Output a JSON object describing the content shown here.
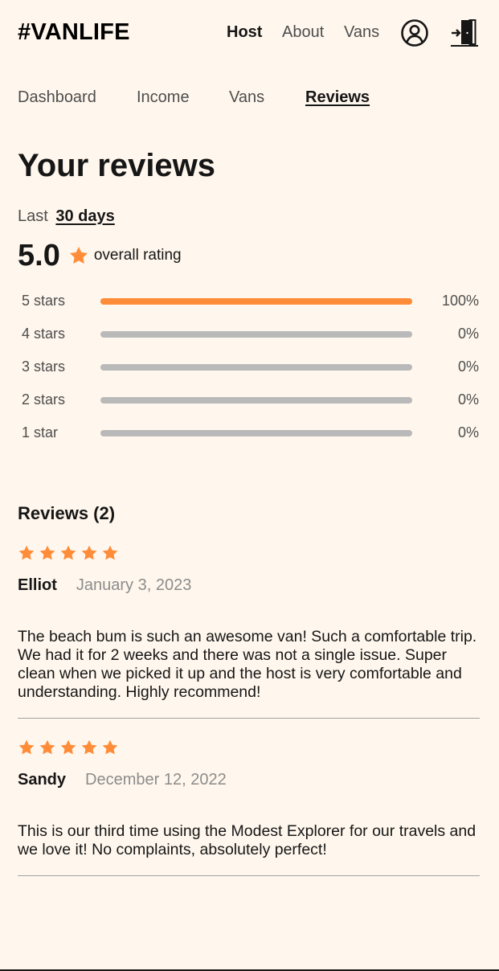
{
  "header": {
    "logo": "#VANLIFE",
    "nav": {
      "host": "Host",
      "about": "About",
      "vans": "Vans"
    },
    "user_icon": "user-circle-icon",
    "logout_icon": "logout-door-icon"
  },
  "subnav": {
    "dashboard": "Dashboard",
    "income": "Income",
    "vans": "Vans",
    "reviews": "Reviews"
  },
  "page": {
    "title": "Your reviews",
    "period_prefix": "Last",
    "period_value": "30 days"
  },
  "rating": {
    "value": "5.0",
    "label": "overall rating",
    "star_icon": "star-icon"
  },
  "distribution": [
    {
      "label": "5 stars",
      "percent_text": "100%",
      "fraction": 1.0
    },
    {
      "label": "4 stars",
      "percent_text": "0%",
      "fraction": 0
    },
    {
      "label": "3 stars",
      "percent_text": "0%",
      "fraction": 0
    },
    {
      "label": "2 stars",
      "percent_text": "0%",
      "fraction": 0
    },
    {
      "label": "1 star",
      "percent_text": "0%",
      "fraction": 0
    }
  ],
  "reviews": {
    "heading": "Reviews (2)",
    "items": [
      {
        "stars": 5,
        "name": "Elliot",
        "date": "January 3, 2023",
        "text": "The beach bum is such an awesome van! Such a comfortable trip. We had it for 2 weeks and there was not a single issue. Super clean when we picked it up and the host is very comfortable and understanding. Highly recommend!"
      },
      {
        "stars": 5,
        "name": "Sandy",
        "date": "December 12, 2022",
        "text": "This is our third time using the Modest Explorer for our travels and we love it! No complaints, absolutely perfect!"
      }
    ]
  },
  "colors": {
    "background": "#FFF7ED",
    "accent": "#FF8C38",
    "bar_empty": "#B9B9B9",
    "text": "#161616",
    "muted": "#4D4D4D"
  }
}
